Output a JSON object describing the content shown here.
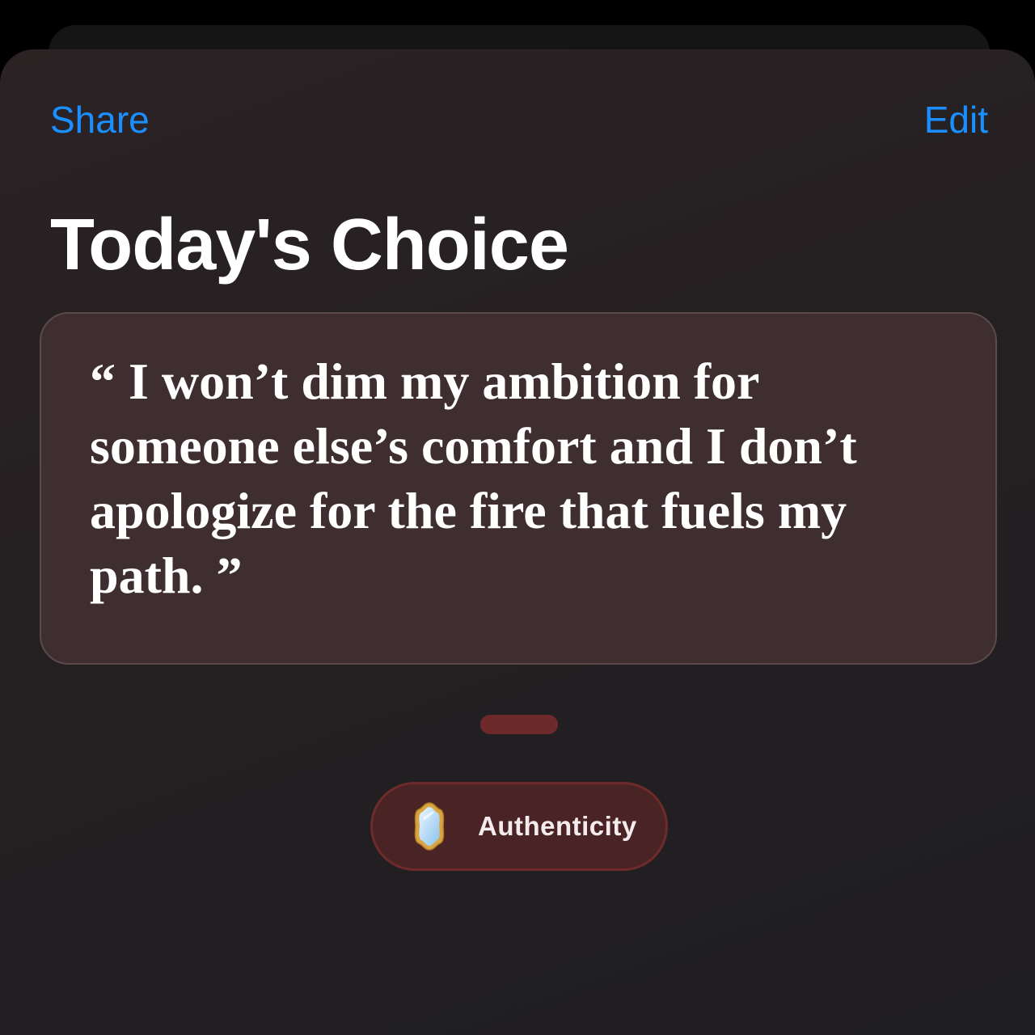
{
  "header": {
    "share_label": "Share",
    "edit_label": "Edit"
  },
  "page_title": "Today's Choice",
  "quote": {
    "text": "“ I won’t dim my ambition for someone else’s comfort and I don’t apologize for the fire that fuels my path. ”"
  },
  "pager": {
    "active_indicator_color": "#6e2a2a"
  },
  "tag": {
    "label": "Authenticity",
    "icon": "mirror-icon"
  },
  "colors": {
    "accent": "#1a8fff",
    "chip_background": "#4a2324",
    "card_background": "#3e2e2f"
  }
}
